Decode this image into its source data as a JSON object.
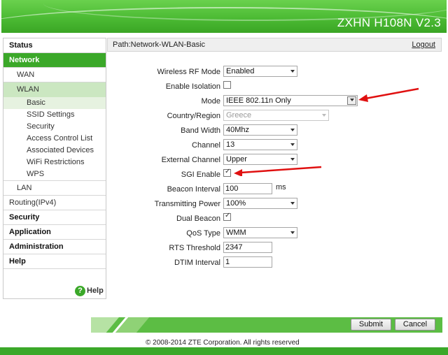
{
  "header": {
    "product": "ZXHN H108N V2.3"
  },
  "sidebar": {
    "status": "Status",
    "network": "Network",
    "wan": "WAN",
    "wlan": "WLAN",
    "wlan_items": [
      "Basic",
      "SSID Settings",
      "Security",
      "Access Control List",
      "Associated Devices",
      "WiFi Restrictions",
      "WPS"
    ],
    "lan": "LAN",
    "routing": "Routing(IPv4)",
    "security": "Security",
    "application": "Application",
    "administration": "Administration",
    "help": "Help",
    "help_link": "Help",
    "help_icon_glyph": "?"
  },
  "path": {
    "text": "Path:Network-WLAN-Basic",
    "logout": "Logout"
  },
  "form": {
    "wireless_rf_mode": {
      "label": "Wireless RF Mode",
      "value": "Enabled"
    },
    "enable_isolation": {
      "label": "Enable Isolation",
      "checked": false
    },
    "mode": {
      "label": "Mode",
      "value": "IEEE 802.11n Only"
    },
    "country_region": {
      "label": "Country/Region",
      "value": "Greece"
    },
    "band_width": {
      "label": "Band Width",
      "value": "40Mhz"
    },
    "channel": {
      "label": "Channel",
      "value": "13"
    },
    "external_channel": {
      "label": "External Channel",
      "value": "Upper"
    },
    "sgi_enable": {
      "label": "SGI Enable",
      "checked": true
    },
    "beacon_interval": {
      "label": "Beacon Interval",
      "value": "100",
      "unit": "ms"
    },
    "transmitting_power": {
      "label": "Transmitting Power",
      "value": "100%"
    },
    "dual_beacon": {
      "label": "Dual Beacon",
      "checked": true
    },
    "qos_type": {
      "label": "QoS Type",
      "value": "WMM"
    },
    "rts_threshold": {
      "label": "RTS Threshold",
      "value": "2347"
    },
    "dtim_interval": {
      "label": "DTIM Interval",
      "value": "1"
    }
  },
  "buttons": {
    "submit": "Submit",
    "cancel": "Cancel"
  },
  "footer": {
    "copyright": "© 2008-2014 ZTE Corporation. All rights reserved"
  },
  "colors": {
    "brand_green": "#3ba829",
    "annotation_red": "#e01010"
  }
}
